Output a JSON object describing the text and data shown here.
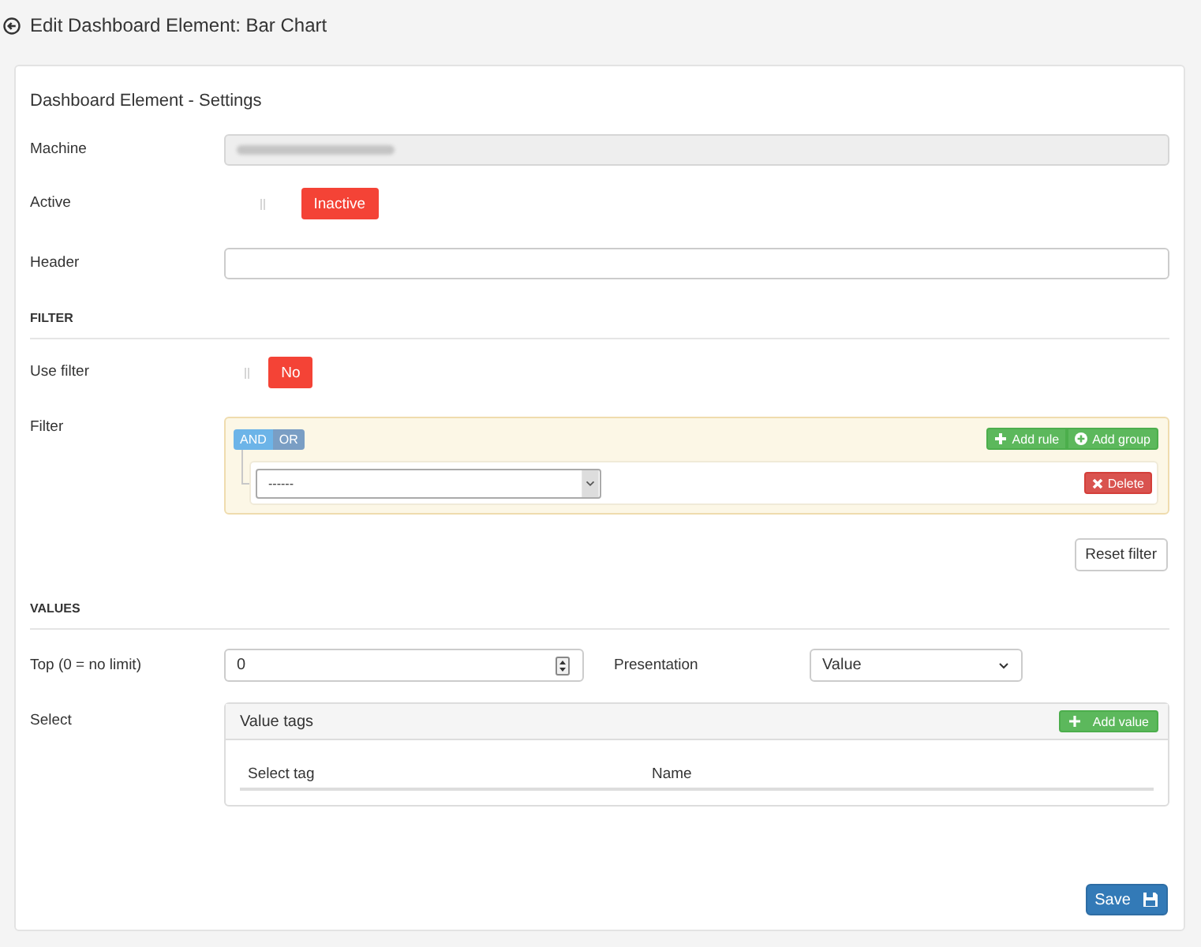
{
  "header": {
    "title": "Edit Dashboard Element: Bar Chart"
  },
  "settings": {
    "heading": "Dashboard Element - Settings",
    "machine": {
      "label": "Machine",
      "disabled": true,
      "blurred": true
    },
    "active": {
      "label": "Active",
      "on": false,
      "state_text": "Inactive"
    },
    "header_field": {
      "label": "Header"
    }
  },
  "filter_section": {
    "title": "FILTER",
    "use_filter": {
      "label": "Use filter",
      "on": false,
      "state_text": "No"
    },
    "filter": {
      "label": "Filter",
      "conditions": [
        {
          "label": "AND",
          "selected": true
        },
        {
          "label": "OR",
          "selected": false
        }
      ],
      "group_actions": [
        {
          "kind": "rule",
          "label": "Add rule"
        },
        {
          "kind": "group",
          "label": "Add group"
        }
      ],
      "rules": [
        {
          "value": "------",
          "delete_label": "Delete"
        }
      ]
    },
    "reset_button": "Reset filter"
  },
  "values_section": {
    "title": "VALUES",
    "top": {
      "label": "Top (0 = no limit)",
      "value": "0"
    },
    "presentation": {
      "label": "Presentation",
      "value": "Value"
    },
    "select": {
      "label": "Select",
      "panel_title": "Value tags",
      "add_button": "Add value",
      "columns": [
        "Select tag",
        "Name"
      ]
    }
  },
  "save_button": "Save"
}
